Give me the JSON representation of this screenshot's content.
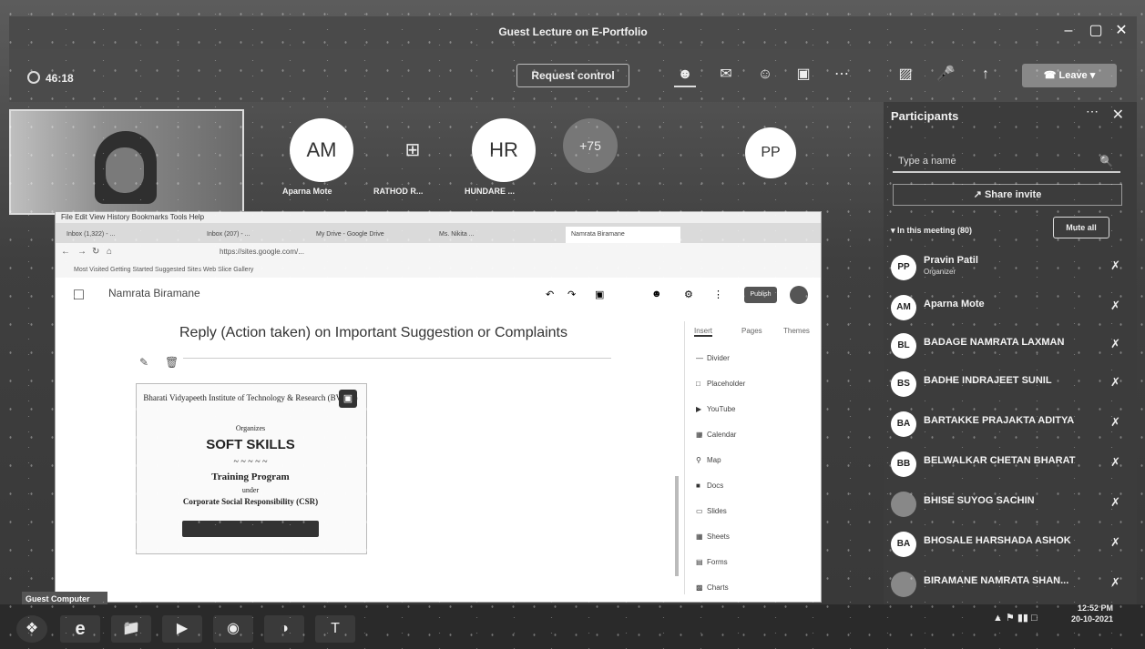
{
  "window": {
    "title": "Guest Lecture on E-Portfolio",
    "controls": [
      "–",
      "▢",
      "✕"
    ]
  },
  "toolbar": {
    "timer": "46:18",
    "request_control": "Request control",
    "leave": "Leave"
  },
  "stage": {
    "tiles": [
      {
        "initials": "AM",
        "name": "Aparna Mote"
      },
      {
        "initials": "⊞",
        "name": "RATHOD R..."
      },
      {
        "initials": "HR",
        "name": "HUNDARE ..."
      },
      {
        "initials": "+75",
        "name": ""
      },
      {
        "initials": "PP",
        "name": ""
      }
    ]
  },
  "participants": {
    "title": "Participants",
    "search_placeholder": "Type a name",
    "share_invite": "Share invite",
    "in_meeting": "In this meeting (80)",
    "mute_all": "Mute all",
    "list": [
      {
        "initials": "PP",
        "name": "Pravin Patil",
        "role": "Organizer"
      },
      {
        "initials": "AM",
        "name": "Aparna Mote",
        "role": ""
      },
      {
        "initials": "BL",
        "name": "BADAGE NAMRATA LAXMAN",
        "role": ""
      },
      {
        "initials": "BS",
        "name": "BADHE INDRAJEET SUNIL",
        "role": ""
      },
      {
        "initials": "BA",
        "name": "BARTAKKE PRAJAKTA ADITYA",
        "role": ""
      },
      {
        "initials": "BB",
        "name": "BELWALKAR CHETAN BHARAT",
        "role": ""
      },
      {
        "initials": "",
        "name": "BHISE SUYOG SACHIN",
        "role": ""
      },
      {
        "initials": "BA",
        "name": "BHOSALE HARSHADA ASHOK",
        "role": ""
      },
      {
        "initials": "",
        "name": "BIRAMANE NAMRATA SHAN...",
        "role": ""
      }
    ]
  },
  "shared_screen": {
    "menubar": "File  Edit  View  History  Bookmarks  Tools  Help",
    "tabs": [
      "Inbox (1,322) - ...",
      "Inbox (207) - ...",
      "My Drive - Google Drive",
      "Ms. Nikita ...",
      "Namrata Biramane"
    ],
    "url": "https://sites.google.com/...",
    "bookmarks": "Most Visited   Getting Started   Suggested Sites   Web Slice Gallery",
    "site_name": "Namrata Biramane",
    "publish": "Publish",
    "heading": "Reply (Action taken) on Important Suggestion or Complaints",
    "certificate": {
      "institute": "Bharati Vidyapeeth Institute of Technology & Research (BVITR)",
      "organizes": "Organizes",
      "title": "SOFT SKILLS",
      "program": "Training Program",
      "under": "under",
      "csr": "Corporate Social Responsibility (CSR)"
    },
    "panel_tabs": [
      "Insert",
      "Pages",
      "Themes"
    ],
    "panel_items": [
      "Divider",
      "Placeholder",
      "YouTube",
      "Calendar",
      "Map",
      "Docs",
      "Slides",
      "Sheets",
      "Forms",
      "Charts"
    ]
  },
  "taskbar": {
    "guest_label": "Guest Computer",
    "time": "12:52 PM",
    "date": "20-10-2021"
  }
}
